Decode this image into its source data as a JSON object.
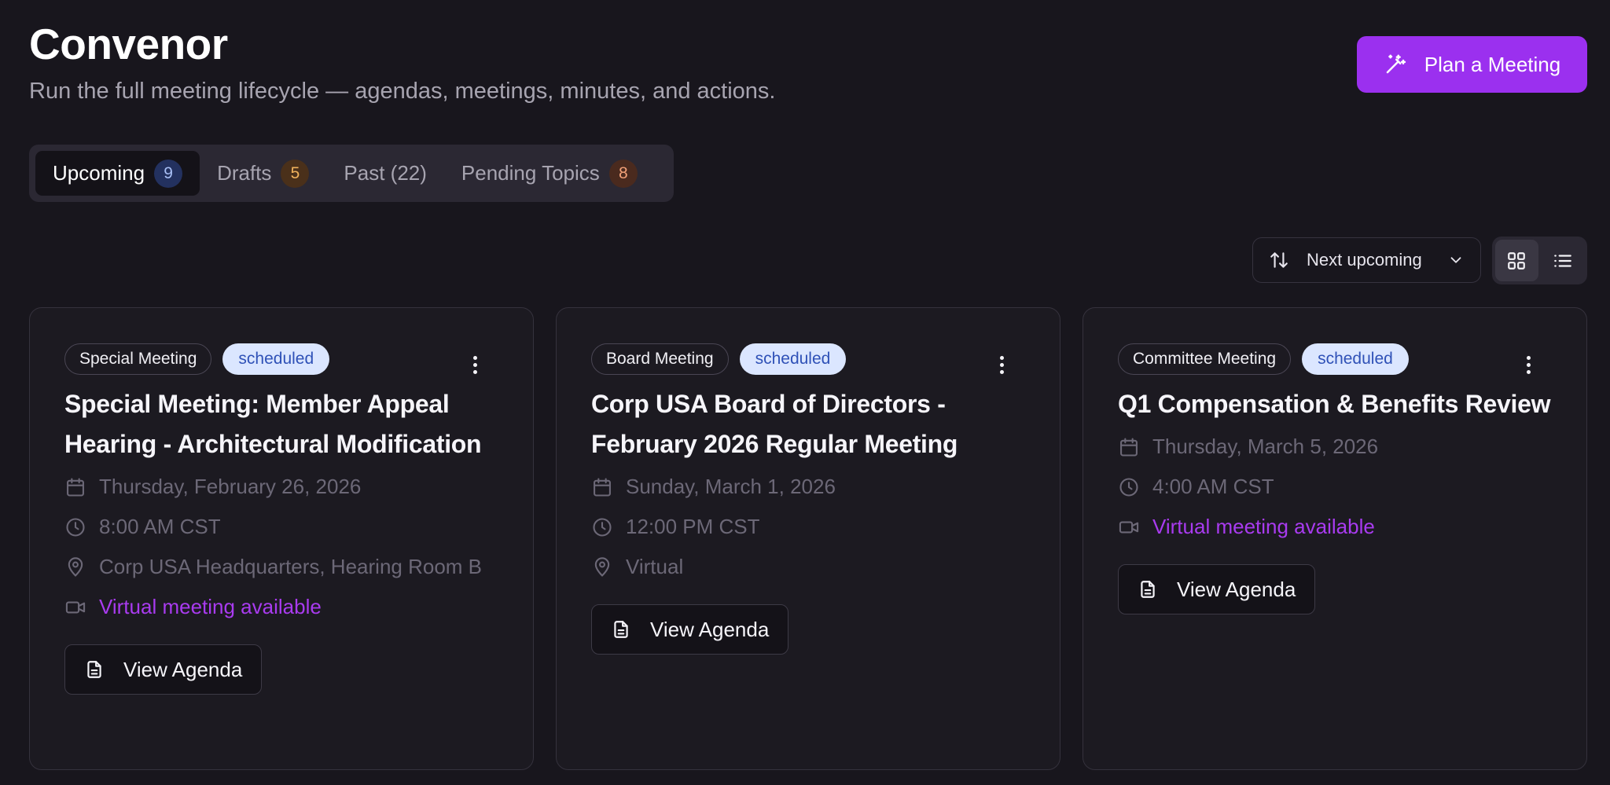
{
  "header": {
    "title": "Convenor",
    "subtitle": "Run the full meeting lifecycle — agendas, meetings, minutes, and actions.",
    "plan_button": "Plan a Meeting",
    "plan_icon": "magic-wand-icon"
  },
  "tabs": [
    {
      "label": "Upcoming",
      "count": "9",
      "active": true
    },
    {
      "label": "Drafts",
      "count": "5",
      "active": false
    },
    {
      "label": "Past (22)",
      "count": null,
      "active": false
    },
    {
      "label": "Pending Topics",
      "count": "8",
      "active": false
    }
  ],
  "toolbar": {
    "sort_label": "Next upcoming",
    "sort_icon": "sort-arrows-icon",
    "view_modes": [
      "grid",
      "list"
    ],
    "active_view": "grid"
  },
  "cards": [
    {
      "type": "Special Meeting",
      "status": "scheduled",
      "title": "Special Meeting: Member Appeal Hearing - Architectural Modification",
      "date": "Thursday, February 26, 2026",
      "time": "8:00 AM CST",
      "location": "Corp USA Headquarters, Hearing Room B",
      "virtual": "Virtual meeting available",
      "button": "View Agenda"
    },
    {
      "type": "Board Meeting",
      "status": "scheduled",
      "title": "Corp USA Board of Directors - February 2026 Regular Meeting",
      "date": "Sunday, March 1, 2026",
      "time": "12:00 PM CST",
      "location": "Virtual",
      "virtual": null,
      "button": "View Agenda"
    },
    {
      "type": "Committee Meeting",
      "status": "scheduled",
      "title": "Q1 Compensation & Benefits Review",
      "date": "Thursday, March 5, 2026",
      "time": "4:00 AM CST",
      "location": null,
      "virtual": "Virtual meeting available",
      "button": "View Agenda"
    }
  ],
  "colors": {
    "background": "#18161d",
    "accent": "#9b30ef",
    "virtual_text": "#a93bf0",
    "status_badge_bg": "#dbe6ff",
    "status_badge_text": "#2f51b7"
  }
}
